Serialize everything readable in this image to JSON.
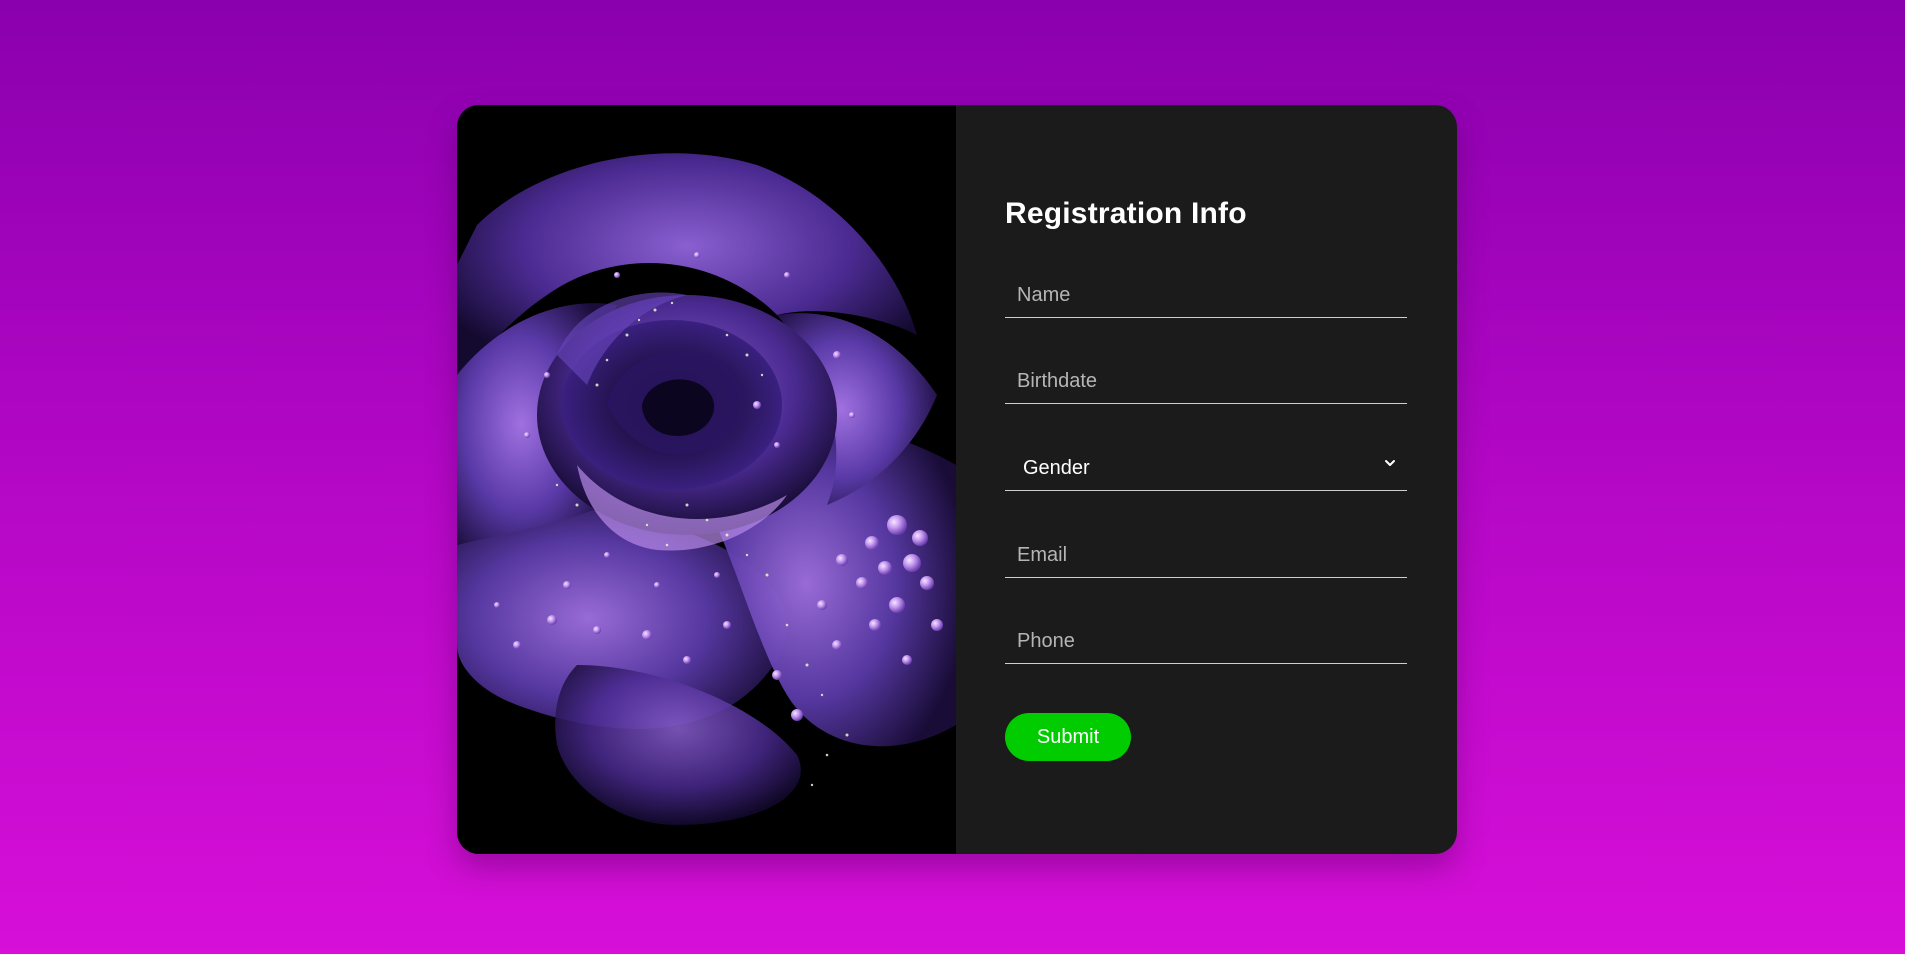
{
  "colors": {
    "background_top": "#8a00ae",
    "background_bottom": "#d70fd8",
    "form_panel": "#1b1b1b",
    "submit_button": "#00cc00"
  },
  "image": {
    "subject": "purple-rose-with-water-droplets"
  },
  "form": {
    "title": "Registration Info",
    "name_placeholder": "Name",
    "birthdate_placeholder": "Birthdate",
    "gender_selected": "Gender",
    "email_placeholder": "Email",
    "phone_placeholder": "Phone",
    "submit_label": "Submit"
  },
  "icons": {
    "select_arrow": "chevron-down-icon"
  }
}
